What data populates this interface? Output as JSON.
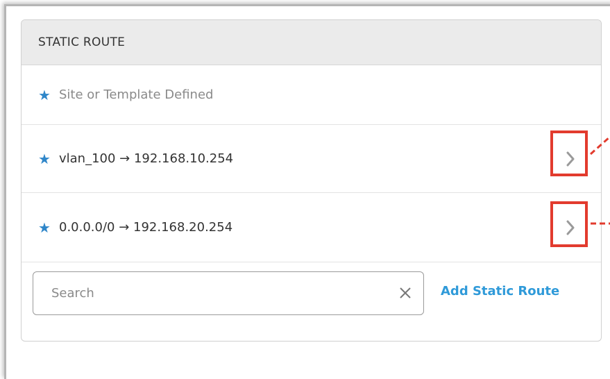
{
  "panel": {
    "title": "STATIC ROUTE"
  },
  "legend": {
    "text": "Site or Template Defined"
  },
  "routes": [
    {
      "label": "vlan_100 → 192.168.10.254"
    },
    {
      "label": "0.0.0.0/0 → 192.168.20.254"
    }
  ],
  "search": {
    "placeholder": "Search",
    "value": ""
  },
  "actions": {
    "add_label": "Add Static Route"
  },
  "icons": {
    "star": "★",
    "route_chevron": "chevron-right-icon",
    "clear": "close-icon"
  },
  "colors": {
    "accent": "#2f86c9",
    "link": "#2f9ad9",
    "highlight": "#e23b2e"
  }
}
